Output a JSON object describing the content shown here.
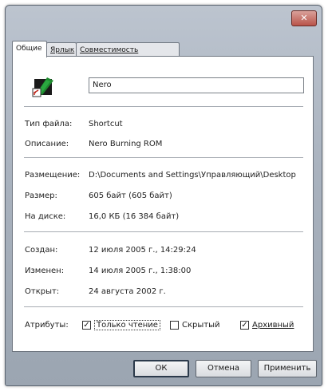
{
  "window": {
    "close_glyph": "✕"
  },
  "tabs": [
    {
      "label": "Общие"
    },
    {
      "label": "Ярлык"
    },
    {
      "label": "Совместимость"
    }
  ],
  "general": {
    "name": "Nero",
    "fields": [
      {
        "label": "Тип файла:",
        "value": "Shortcut"
      },
      {
        "label": "Описание:",
        "value": "Nero Burning ROM"
      }
    ],
    "location_fields": [
      {
        "label": "Размещение:",
        "value": "D:\\Documents and Settings\\Управляющий\\Desktop"
      },
      {
        "label": "Размер:",
        "value": "605 байт (605 байт)"
      },
      {
        "label": "На диске:",
        "value": "16,0 КБ (16 384 байт)"
      }
    ],
    "date_fields": [
      {
        "label": "Создан:",
        "value": "12 июля 2005 г., 14:29:24"
      },
      {
        "label": "Изменен:",
        "value": "14 июля 2005 г., 1:38:00"
      },
      {
        "label": "Открыт:",
        "value": "24 августа 2002 г."
      }
    ],
    "attributes": {
      "label": "Атрибуты:",
      "items": [
        {
          "label": "Только чтение",
          "checked": true
        },
        {
          "label": "Скрытый",
          "checked": false
        },
        {
          "label": "Архивный",
          "checked": true
        }
      ]
    }
  },
  "buttons": {
    "ok": "ОК",
    "cancel": "Отмена",
    "apply": "Применить"
  },
  "colors": {
    "icon_green": "#1e8a2e",
    "icon_dark": "#1a1a1a",
    "icon_red": "#c0261a"
  }
}
